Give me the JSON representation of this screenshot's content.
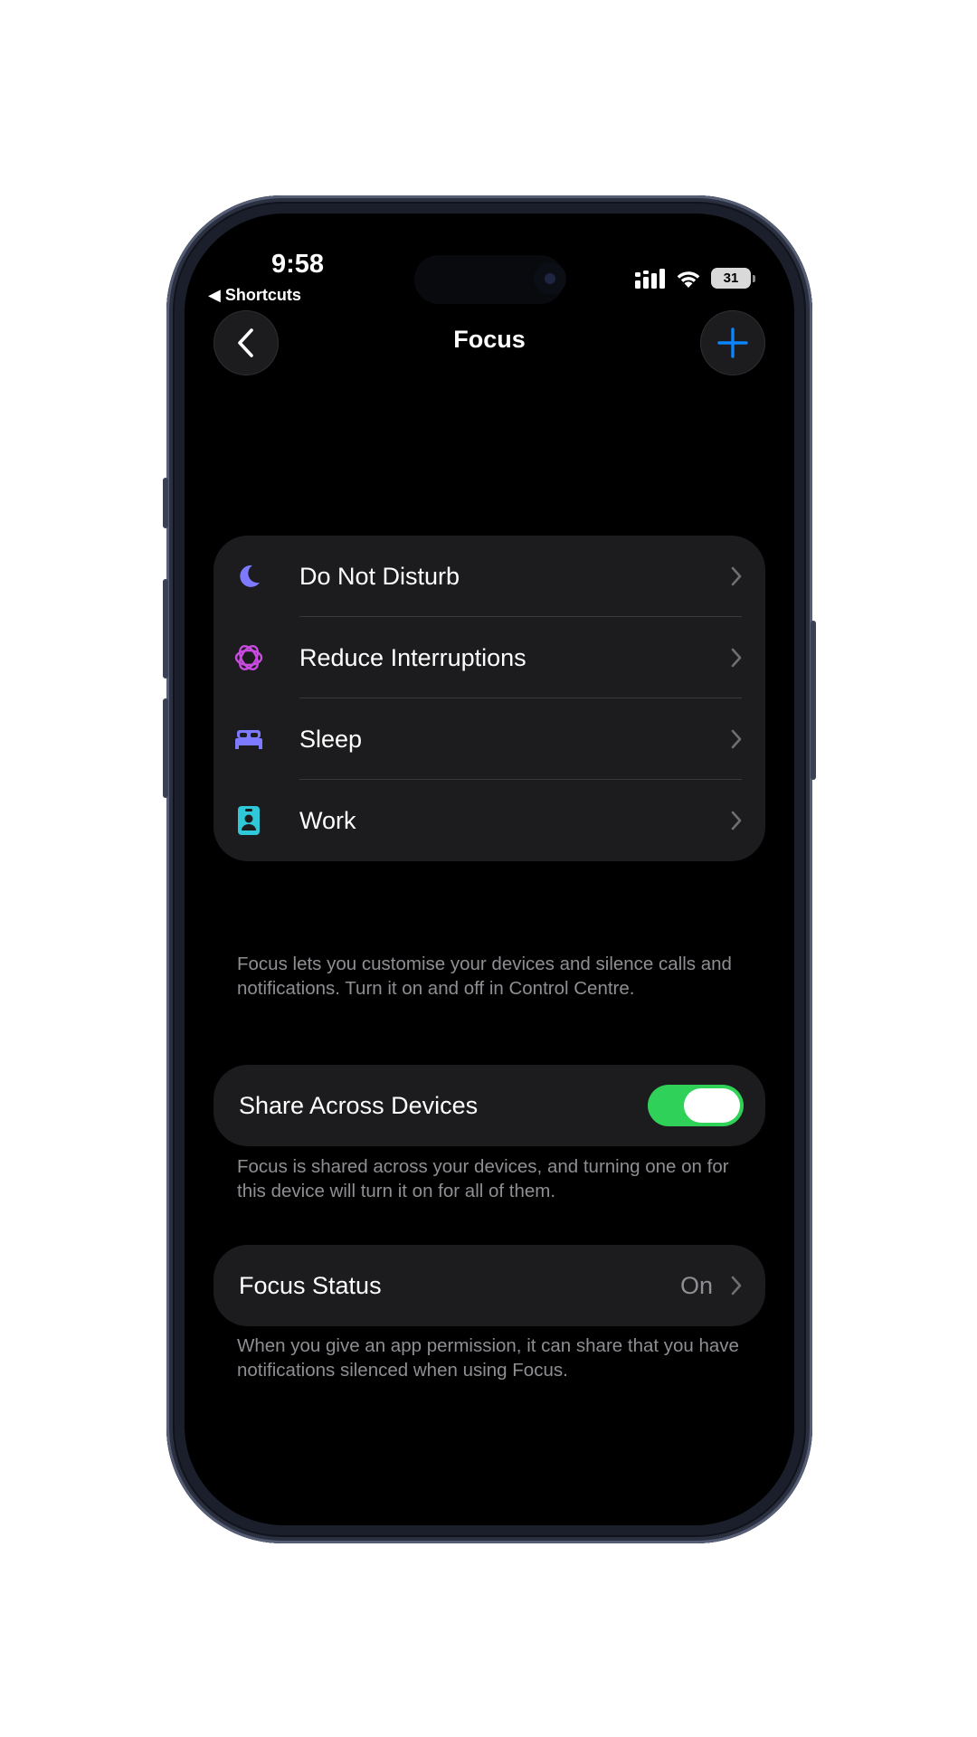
{
  "status_bar": {
    "time": "9:58",
    "back_app": "◀ Shortcuts",
    "battery": "31"
  },
  "nav": {
    "title": "Focus"
  },
  "focus_modes": [
    {
      "label": "Do Not Disturb",
      "icon": "moon-icon",
      "color": "#7d7aff"
    },
    {
      "label": "Reduce Interruptions",
      "icon": "interruptions-icon",
      "color": "#c94be0"
    },
    {
      "label": "Sleep",
      "icon": "bed-icon",
      "color": "#7d7aff"
    },
    {
      "label": "Work",
      "icon": "id-badge-icon",
      "color": "#2ec8d8"
    }
  ],
  "focus_footer": "Focus lets you customise your devices and silence calls and notifications. Turn it on and off in Control Centre.",
  "share": {
    "label": "Share Across Devices",
    "enabled": true,
    "footer": "Focus is shared across your devices, and turning one on for this device will turn it on for all of them."
  },
  "focus_status": {
    "label": "Focus Status",
    "value": "On",
    "footer": "When you give an app permission, it can share that you have notifications silenced when using Focus."
  },
  "colors": {
    "accent_blue": "#0a84ff",
    "toggle_green": "#30d158",
    "cell_bg": "#1c1c1e"
  }
}
